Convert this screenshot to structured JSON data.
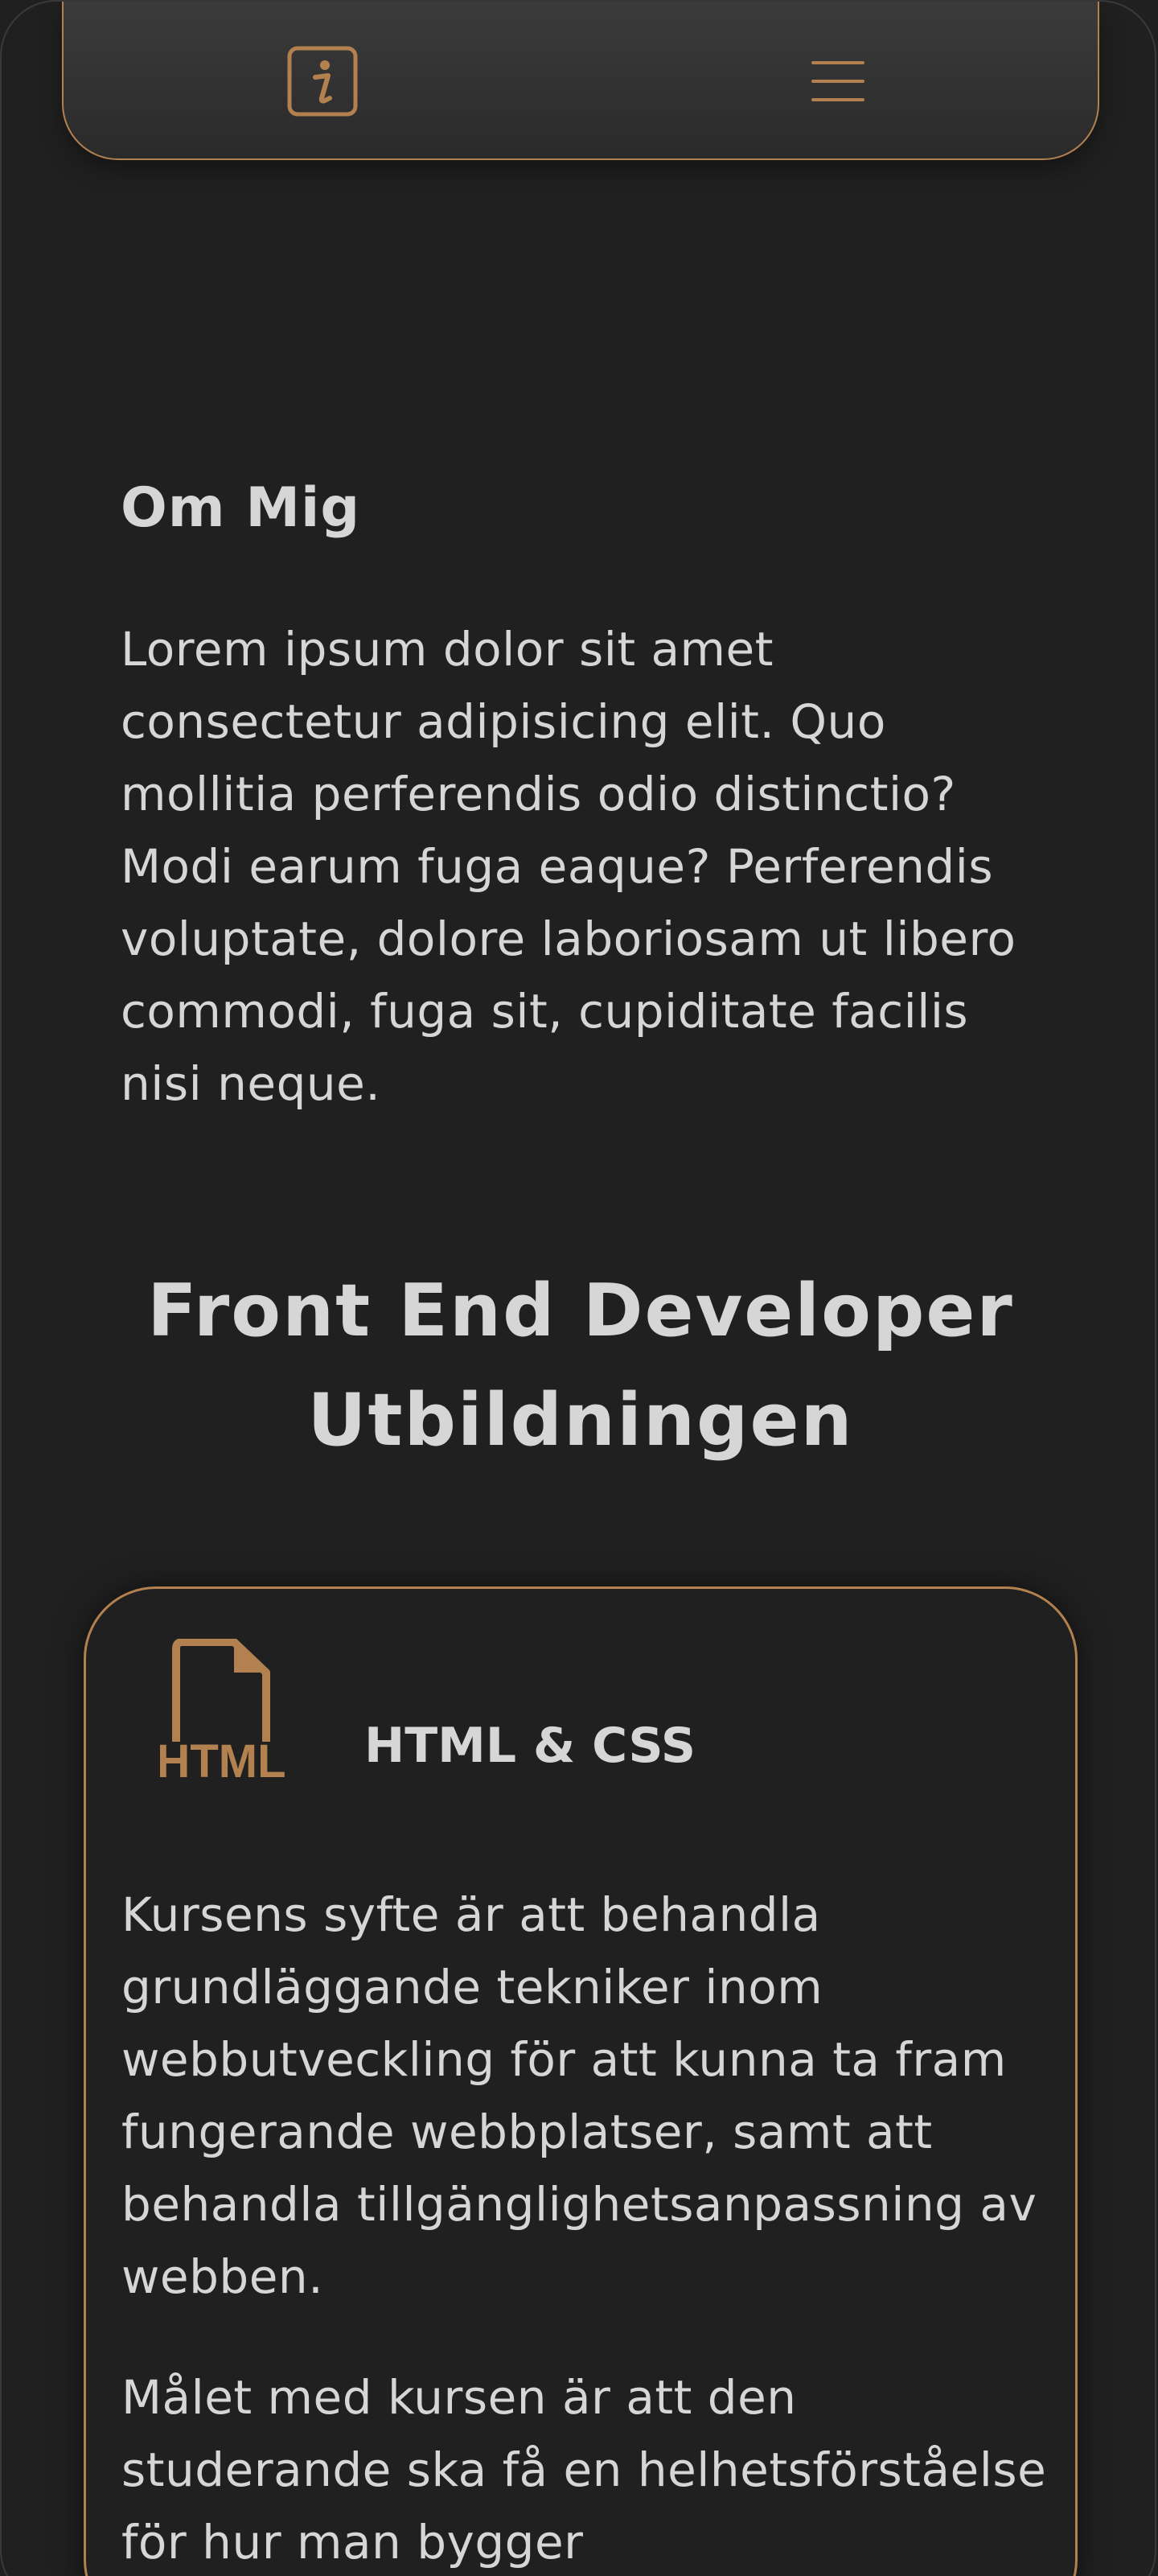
{
  "colors": {
    "background": "#202020",
    "accent": "#b3804f",
    "text": "#d6d6d6"
  },
  "navbar": {
    "info_icon": "info-icon",
    "menu_icon": "hamburger-menu-icon"
  },
  "about": {
    "title": "Om Mig",
    "text": "Lorem ipsum dolor sit amet consectetur adipisicing elit. Quo mollitia perferendis odio distinctio? Modi earum fuga eaque? Perferendis voluptate, dolore laboriosam ut libero commodi, fuga sit, cupiditate facilis nisi neque."
  },
  "education": {
    "title": "Front End Developer Utbildningen"
  },
  "courses": [
    {
      "icon": "html-file-icon",
      "icon_text": "HTML",
      "name": "HTML & CSS",
      "paragraphs": [
        "Kursens syfte är att behandla grundläggande tekniker inom webbutveckling för att kunna ta fram fungerande webbplatser, samt att behandla tillgänglighetsanpassning av webben.",
        "Målet med kursen är att den studerande ska få en helhetsförståelse för hur man bygger"
      ]
    }
  ]
}
